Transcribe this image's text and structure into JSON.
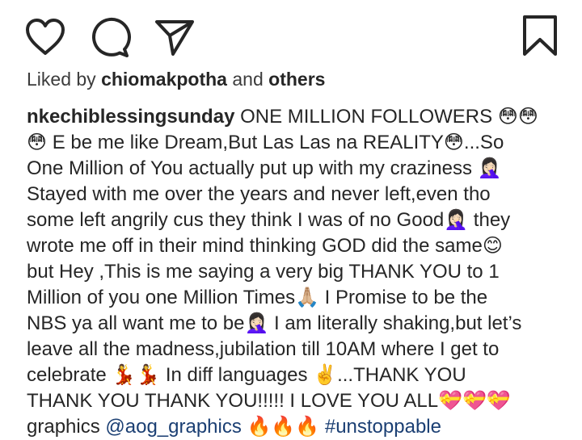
{
  "actions": {
    "like_icon": "heart-icon",
    "comment_icon": "comment-icon",
    "share_icon": "paper-plane-icon",
    "save_icon": "bookmark-icon"
  },
  "likes": {
    "prefix": "Liked by ",
    "user": "chiomakpotha",
    "conjunction": " and ",
    "others": "others"
  },
  "caption": {
    "username": "nkechiblessingsunday",
    "lines": [
      " ONE MILLION FOLLOWERS 😳😳",
      "😳 E be me like Dream,But Las Las na REALITY😳...So",
      "One Million of You actually put up with my craziness 🤦🏻‍♀️",
      "Stayed with me over the years and never left,even tho",
      "some left angrily cus they think I was of no Good🤦🏻‍♀️ they",
      "wrote me off in their mind thinking GOD did the same😊",
      "but Hey ,This is me saying a very big THANK YOU to 1",
      "Million of you one Million Times🙏🏼 I Promise to be the",
      "NBS ya all want me to be🤦🏻‍♀️ I am literally shaking,but let’s",
      "leave all the madness,jubilation till 10AM where I get to",
      "celebrate 💃💃 In diff languages ✌️...THANK YOU",
      "THANK YOU THANK YOU!!!!! I LOVE YOU ALL💝💝💝"
    ],
    "last_line_prefix": "graphics ",
    "mention": "@aog_graphics",
    "fire": " 🔥🔥🔥 ",
    "hashtag": "#unstoppable"
  },
  "colors": {
    "text": "#262626",
    "link": "#1b3f73",
    "icon": "#262626"
  }
}
